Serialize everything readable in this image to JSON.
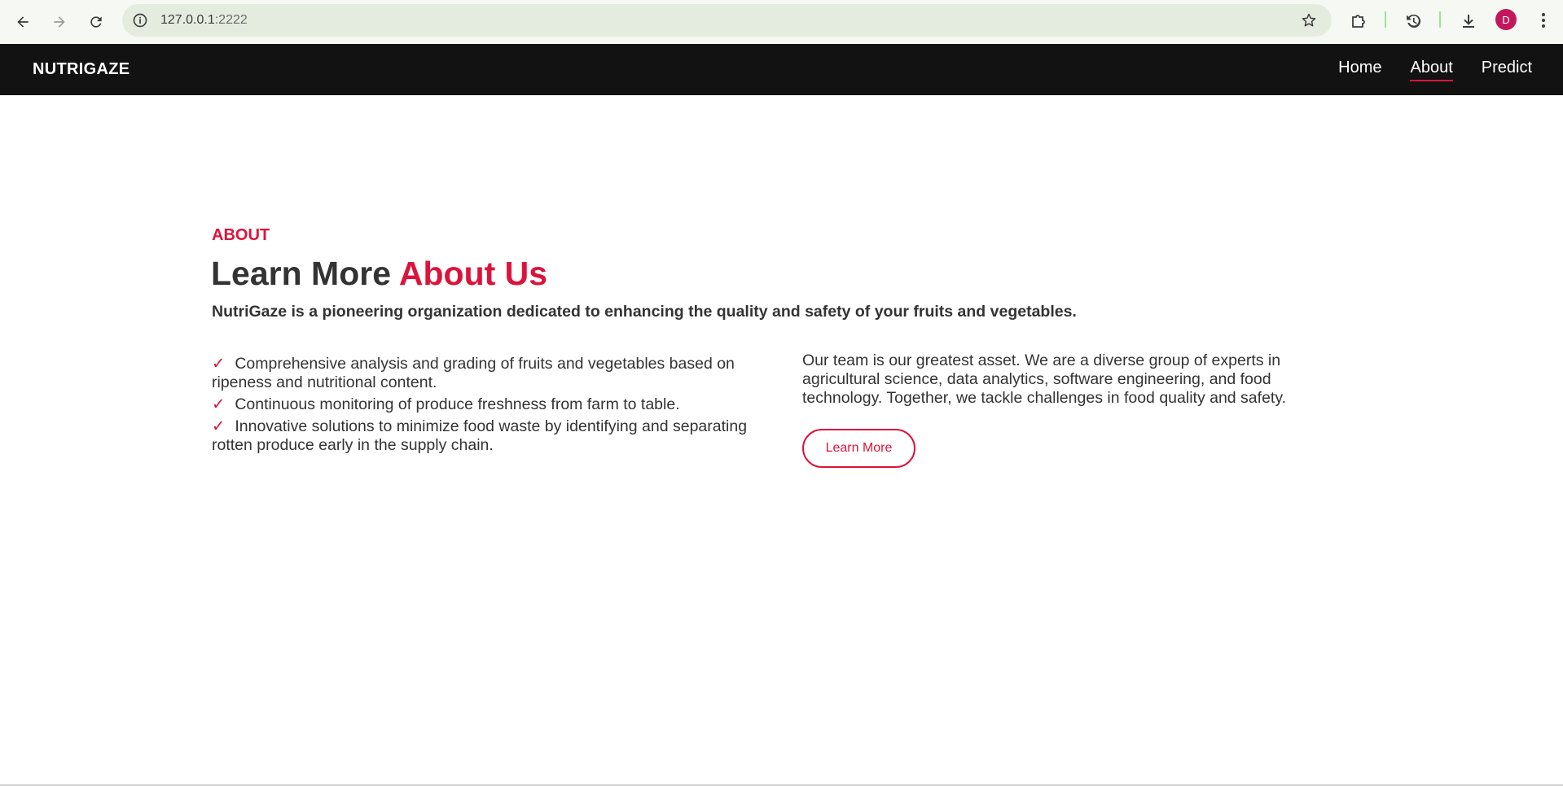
{
  "browser": {
    "url_host": "127.0.0.1",
    "url_port": ":2222",
    "avatar_letter": "D"
  },
  "nav": {
    "brand": "NUTRIGAZE",
    "links": [
      {
        "label": "Home",
        "active": false
      },
      {
        "label": "About",
        "active": true
      },
      {
        "label": "Predict",
        "active": false
      }
    ]
  },
  "about": {
    "label": "ABOUT",
    "title_main": "Learn More ",
    "title_accent": "About Us",
    "lead": "NutriGaze is a pioneering organization dedicated to enhancing the quality and safety of your fruits and vegetables.",
    "check_symbol": "✓",
    "features": [
      "Comprehensive analysis and grading of fruits and vegetables based on ripeness and nutritional content.",
      "Continuous monitoring of produce freshness from farm to table.",
      "Innovative solutions to minimize food waste by identifying and separating rotten produce early in the supply chain."
    ],
    "team_text": "Our team is our greatest asset. We are a diverse group of experts in agricultural science, data analytics, software engineering, and food technology. Together, we tackle challenges in food quality and safety.",
    "button_label": "Learn More"
  },
  "colors": {
    "accent": "#dc143c",
    "navbar_bg": "#121212",
    "text": "#333333"
  }
}
